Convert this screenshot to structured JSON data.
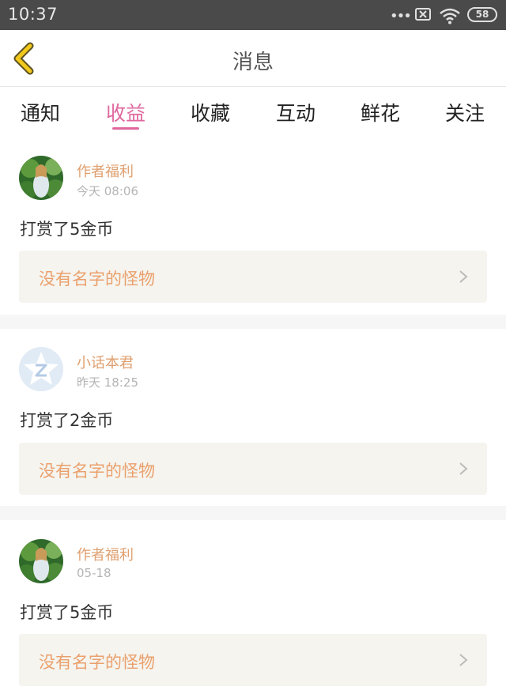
{
  "status_bar": {
    "time": "10:37",
    "signal_dots": "•••",
    "battery": "58",
    "icons": [
      "more-dots-icon",
      "no-sim-icon",
      "wifi-icon",
      "battery-icon"
    ]
  },
  "header": {
    "title": "消息",
    "back_icon": "back-chevron-icon",
    "accent_color": "#f2c81c"
  },
  "tabs": [
    {
      "label": "通知",
      "active": false
    },
    {
      "label": "收益",
      "active": true
    },
    {
      "label": "收藏",
      "active": false
    },
    {
      "label": "互动",
      "active": false
    },
    {
      "label": "鲜花",
      "active": false
    },
    {
      "label": "关注",
      "active": false
    }
  ],
  "theme": {
    "active_tab_color": "#e0679e",
    "name_color": "#e0a070",
    "link_bg": "#f5f4ef"
  },
  "messages": [
    {
      "sender": "作者福利",
      "time": "今天 08:06",
      "text": "打赏了5金币",
      "work_title": "没有名字的怪物",
      "avatar": "photo-avatar"
    },
    {
      "sender": "小话本君",
      "time": "昨天 18:25",
      "text": "打赏了2金币",
      "work_title": "没有名字的怪物",
      "avatar": "star-logo-avatar"
    },
    {
      "sender": "作者福利",
      "time": "05-18",
      "text": "打赏了5金币",
      "work_title": "没有名字的怪物",
      "avatar": "photo-avatar"
    }
  ]
}
